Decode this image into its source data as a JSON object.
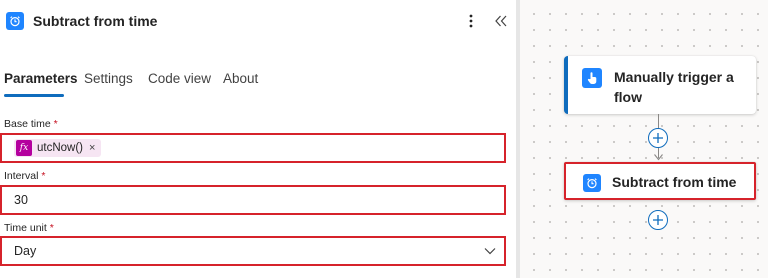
{
  "panel": {
    "title": "Subtract from time",
    "icon": "alarm-clock-icon",
    "more_label": "⋮",
    "collapse_label": "«"
  },
  "tabs": [
    {
      "label": "Parameters",
      "active": true
    },
    {
      "label": "Settings",
      "active": false
    },
    {
      "label": "Code view",
      "active": false
    },
    {
      "label": "About",
      "active": false
    }
  ],
  "fields": {
    "base_time": {
      "label": "Base time",
      "required_mark": "*",
      "token": {
        "icon_text": "fx",
        "label": "utcNow()",
        "remove_label": "×"
      }
    },
    "interval": {
      "label": "Interval",
      "required_mark": "*",
      "value": "30"
    },
    "time_unit": {
      "label": "Time unit",
      "required_mark": "*",
      "value": "Day"
    }
  },
  "canvas": {
    "trigger_card": {
      "title": "Manually trigger a flow",
      "icon": "touch-hand-icon"
    },
    "action_card": {
      "title": "Subtract from time",
      "icon": "alarm-clock-icon"
    },
    "add_button_label": "+"
  },
  "colors": {
    "accent": "#0f6cbd",
    "highlight": "#d6232b",
    "action_icon": "#1f85ff",
    "expression_token": "#b4009e"
  }
}
